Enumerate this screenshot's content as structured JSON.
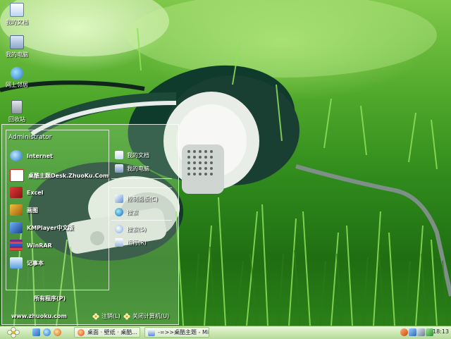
{
  "desktop": {
    "icons": [
      {
        "label": "我的文档",
        "icon": "my-documents-icon"
      },
      {
        "label": "我的电脑",
        "icon": "my-computer-icon"
      },
      {
        "label": "网上邻居",
        "icon": "network-places-icon"
      },
      {
        "label": "回收站",
        "icon": "recycle-bin-icon"
      }
    ]
  },
  "start_menu": {
    "user": "Administrator",
    "programs": [
      {
        "label": "Internet",
        "icon": "ie-icon"
      },
      {
        "label": "桌酷主题Desk.ZhuoKu.Com",
        "icon": "zhuoku-icon"
      },
      {
        "label": "Excel",
        "icon": "excel-icon"
      },
      {
        "label": "画图",
        "icon": "paint-icon"
      },
      {
        "label": "KMPlayer中文版",
        "icon": "kmplayer-icon"
      },
      {
        "label": "WinRAR",
        "icon": "winrar-icon"
      },
      {
        "label": "记事本",
        "icon": "notepad-icon"
      }
    ],
    "right_items": [
      {
        "label": "我的文档",
        "icon": "my-documents-icon"
      },
      {
        "label": "我的电脑",
        "icon": "my-computer-icon"
      },
      {
        "label": "控制面板(C)",
        "icon": "control-panel-icon"
      },
      {
        "label": "搜索",
        "icon": "search-globe-icon"
      },
      {
        "label": "搜索(S)",
        "icon": "search-icon"
      },
      {
        "label": "运行(R)",
        "icon": "run-icon"
      }
    ],
    "all_programs": "所有程序(P)",
    "website": "www.zhuoku.com",
    "logoff": "注销(L)",
    "shutdown": "关闭计算机(U)"
  },
  "taskbar": {
    "tasks": [
      {
        "label": "桌面 · 壁纸 · 桌酷...",
        "icon": "browser-task-icon"
      },
      {
        "label": "-=>>桌酷主题 - Mi...",
        "icon": "document-task-icon"
      }
    ],
    "clock": "18:13"
  }
}
